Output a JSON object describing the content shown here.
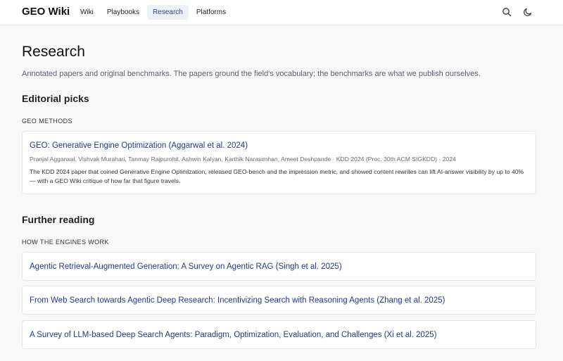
{
  "header": {
    "brand": "GEO Wiki",
    "nav": [
      {
        "label": "Wiki",
        "active": false
      },
      {
        "label": "Playbooks",
        "active": false
      },
      {
        "label": "Research",
        "active": true
      },
      {
        "label": "Platforms",
        "active": false
      }
    ],
    "icons": [
      "search-icon",
      "moon-icon"
    ]
  },
  "page": {
    "title": "Research",
    "lede": "Annotated papers and original benchmarks. The papers ground the field's vocabulary; the benchmarks are what we publish ourselves."
  },
  "editorial": {
    "heading": "Editorial picks",
    "group_label": "GEO METHODS",
    "featured": {
      "title": "GEO: Generative Engine Optimization (Aggarwal et al. 2024)",
      "meta": "Pranjal Aggarwal, Vishvak Murahari, Tanmay Rajpurohit, Ashwin Kalyan, Karthik Narasimhan, Ameet Deshpande · KDD 2024 (Proc. 30th ACM SIGKDD) · 2024",
      "description": "The KDD 2024 paper that coined Generative Engine Optimization, released GEO-bench and the impression metric, and showed content rewrites can lift AI-answer visibility by up to 40% — with a GEO Wiki critique of how far that figure travels."
    }
  },
  "further": {
    "heading": "Further reading",
    "group_label": "HOW THE ENGINES WORK",
    "items": [
      {
        "title": "Agentic Retrieval-Augmented Generation: A Survey on Agentic RAG (Singh et al. 2025)"
      },
      {
        "title": "From Web Search towards Agentic Deep Research: Incentivizing Search with Reasoning Agents (Zhang et al. 2025)"
      },
      {
        "title": "A Survey of LLM-based Deep Search Agents: Paradigm, Optimization, Evaluation, and Challenges (Xi et al. 2025)"
      }
    ]
  },
  "colors": {
    "link": "#27378a",
    "active_nav_bg": "#eef1f8",
    "page_bg": "#f8f8f9"
  }
}
